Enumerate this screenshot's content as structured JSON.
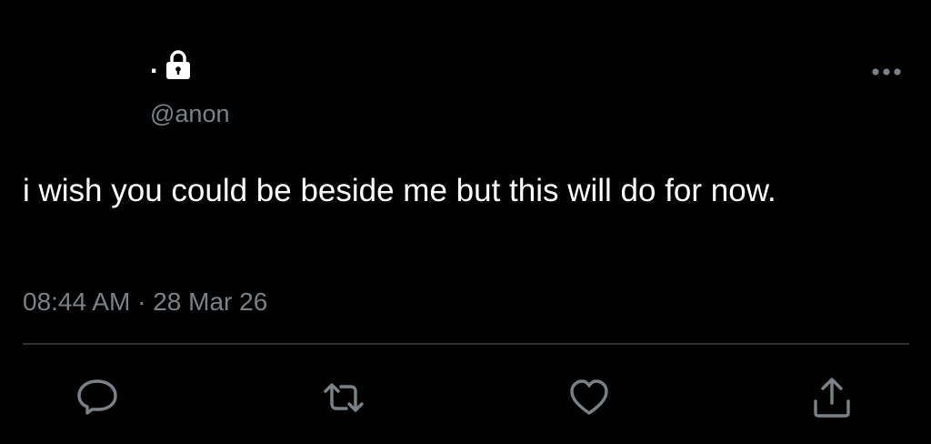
{
  "author": {
    "display_name": ".",
    "handle": "@anon",
    "protected_icon": "lock-icon"
  },
  "menu": {
    "icon": "more-horizontal-icon"
  },
  "tweet": {
    "text": "i wish you could be beside me but this will do for now.",
    "time": "08:44 AM",
    "separator": "·",
    "date": "28 Mar 26"
  },
  "actions": [
    {
      "icon": "reply-icon"
    },
    {
      "icon": "retweet-icon"
    },
    {
      "icon": "like-icon"
    },
    {
      "icon": "share-icon"
    }
  ],
  "colors": {
    "background": "#000000",
    "primary_text": "#ffffff",
    "secondary_text": "#7a8287",
    "divider": "#2c3135",
    "icon": "#7a8287"
  }
}
